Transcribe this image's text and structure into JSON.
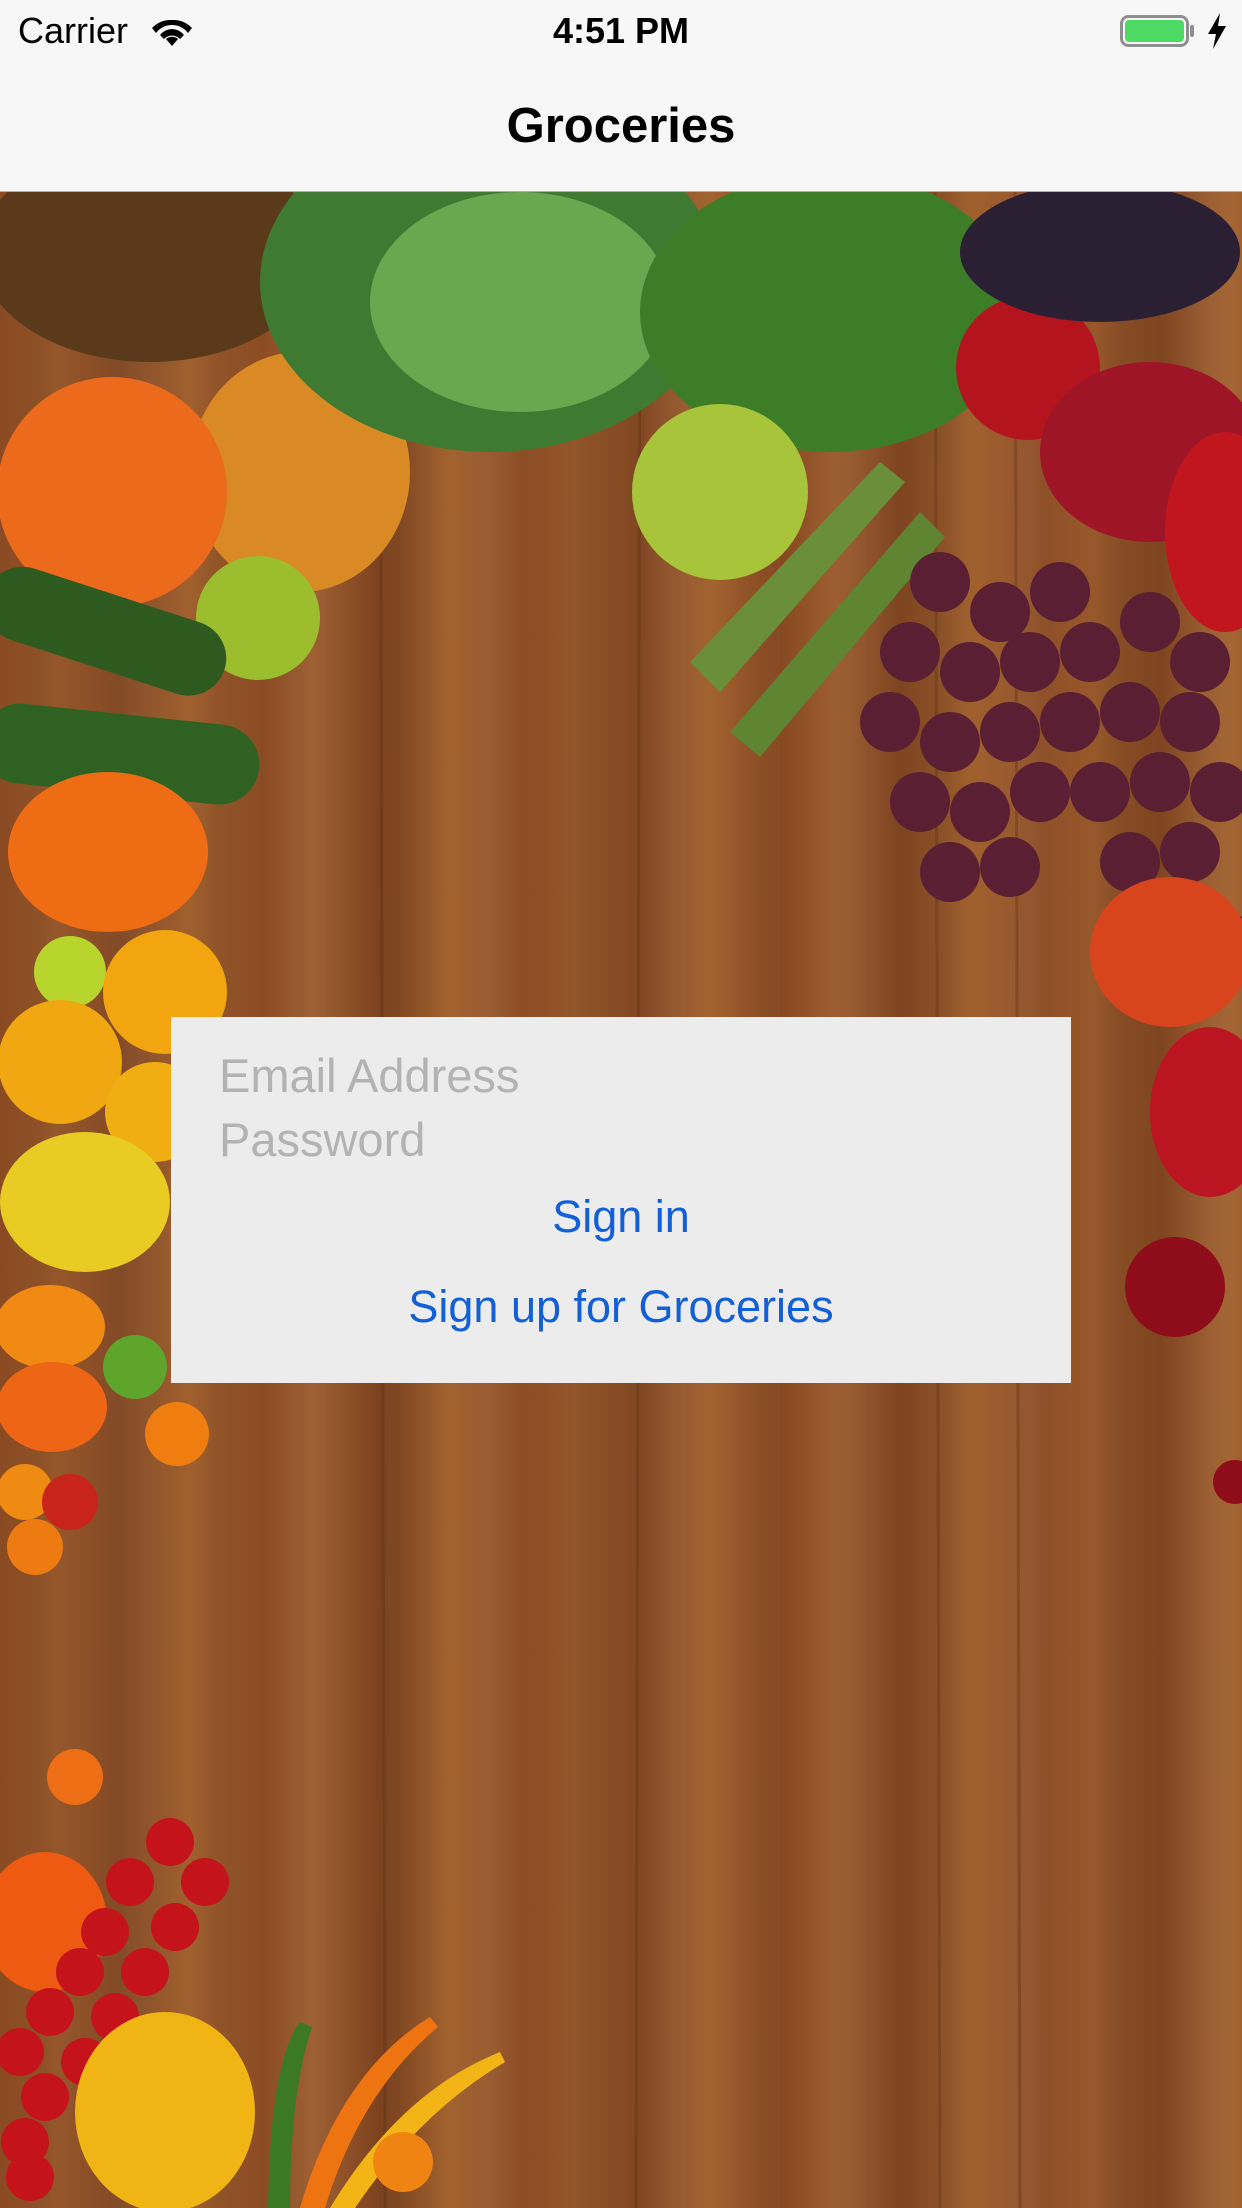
{
  "status_bar": {
    "carrier": "Carrier",
    "time": "4:51 PM",
    "icons": [
      "wifi-icon",
      "battery-icon",
      "charging-bolt-icon"
    ]
  },
  "nav": {
    "title": "Groceries"
  },
  "login": {
    "email_placeholder": "Email Address",
    "email_value": "",
    "password_placeholder": "Password",
    "password_value": "",
    "sign_in_label": "Sign in",
    "sign_up_label": "Sign up for Groceries"
  },
  "colors": {
    "accent": "#1260d8",
    "card_background": "#ececec",
    "bar_background": "#f7f7f7",
    "battery_fill": "#4cd964",
    "wood": "#8b4d25"
  }
}
